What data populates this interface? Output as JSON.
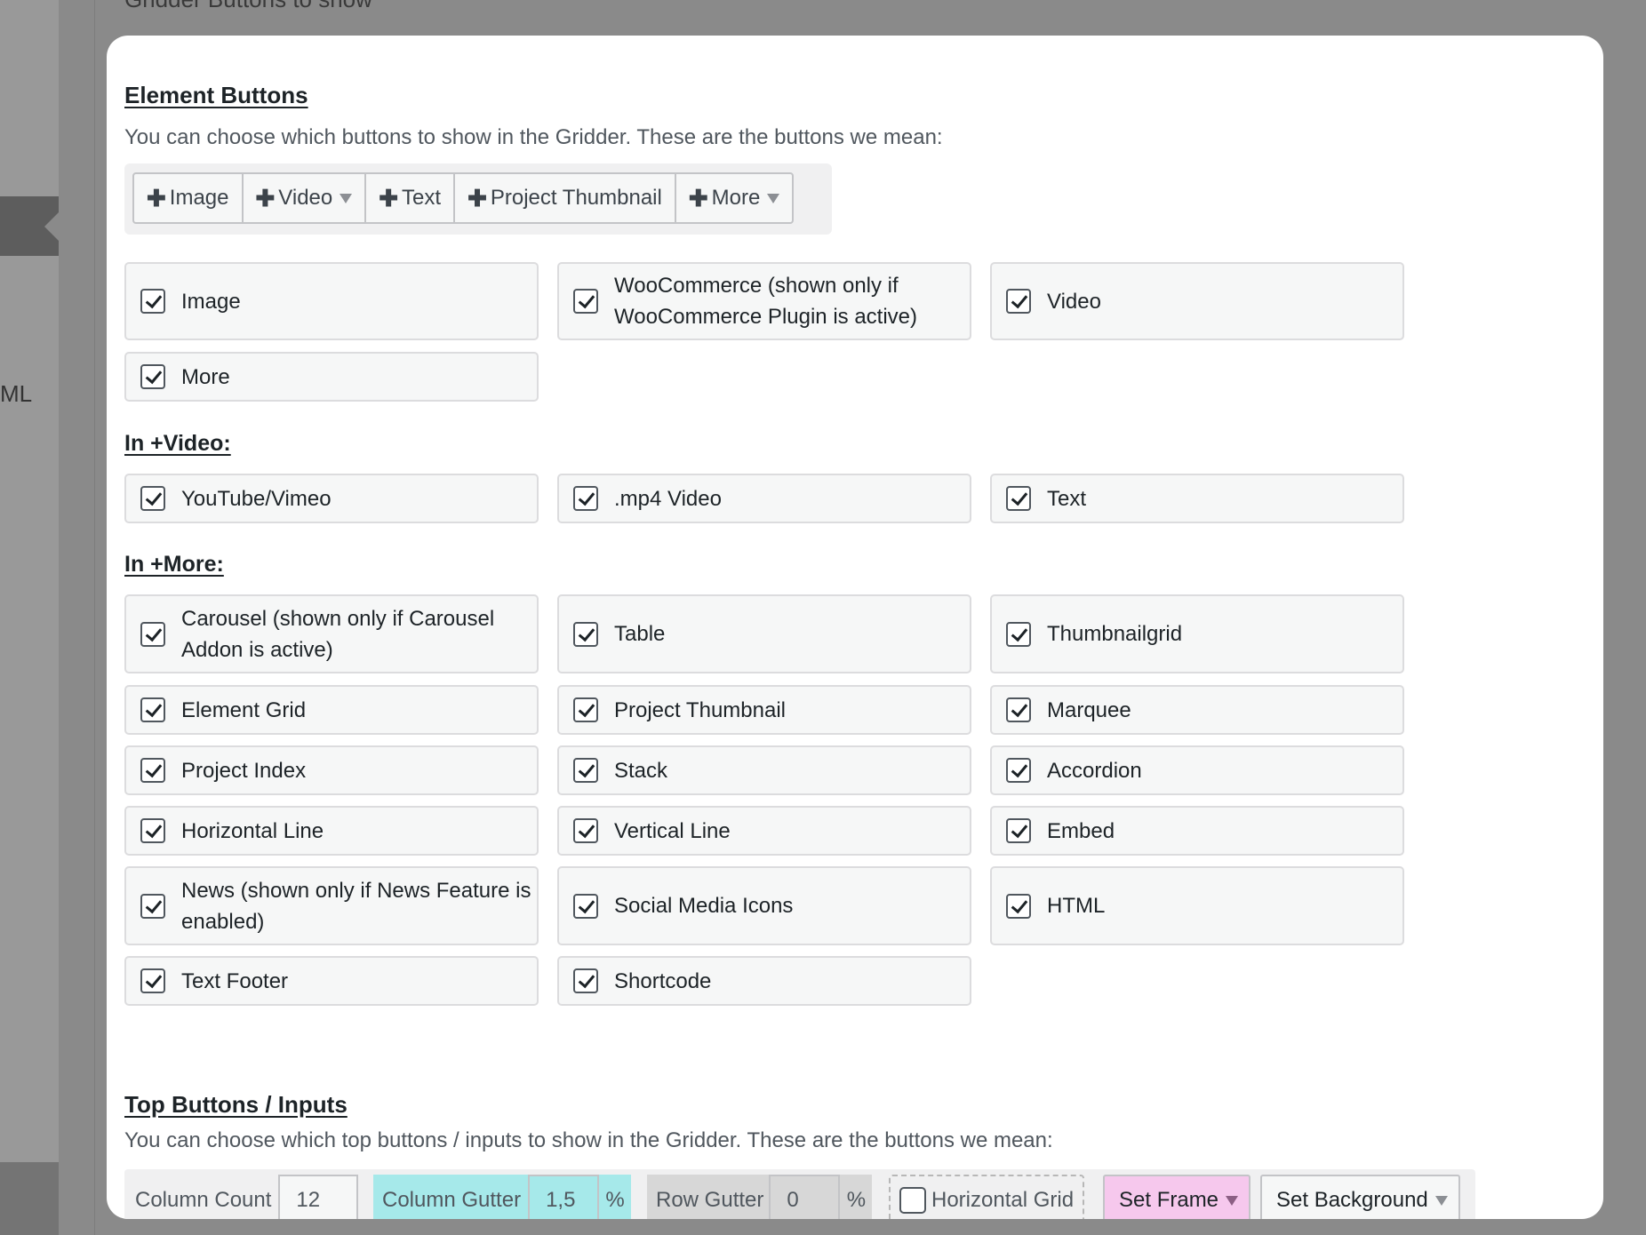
{
  "background": {
    "top_text": "Gridder Buttons to show",
    "side_text": "ML"
  },
  "element_buttons": {
    "heading": "Element Buttons",
    "description": "You can choose which buttons to show in the Gridder. These are the buttons we mean:",
    "sample_buttons": [
      {
        "label": "Image",
        "has_dropdown": false
      },
      {
        "label": "Video",
        "has_dropdown": true
      },
      {
        "label": "Text",
        "has_dropdown": false
      },
      {
        "label": "Project Thumbnail",
        "has_dropdown": false
      },
      {
        "label": "More",
        "has_dropdown": true
      }
    ],
    "options": [
      {
        "label": "Image",
        "checked": true
      },
      {
        "label": "WooCommerce (shown only if WooCommerce Plugin is active)",
        "checked": true
      },
      {
        "label": "Video",
        "checked": true
      },
      {
        "label": "More",
        "checked": true
      }
    ]
  },
  "in_video": {
    "heading": "In +Video:",
    "options": [
      {
        "label": "YouTube/Vimeo",
        "checked": true
      },
      {
        "label": ".mp4 Video",
        "checked": true
      },
      {
        "label": "Text",
        "checked": true
      }
    ]
  },
  "in_more": {
    "heading": "In +More:",
    "options": [
      {
        "label": "Carousel (shown only if Carousel Addon is active)",
        "checked": true
      },
      {
        "label": "Table",
        "checked": true
      },
      {
        "label": "Thumbnailgrid",
        "checked": true
      },
      {
        "label": "Element Grid",
        "checked": true
      },
      {
        "label": "Project Thumbnail",
        "checked": true
      },
      {
        "label": "Marquee",
        "checked": true
      },
      {
        "label": "Project Index",
        "checked": true
      },
      {
        "label": "Stack",
        "checked": true
      },
      {
        "label": "Accordion",
        "checked": true
      },
      {
        "label": "Horizontal Line",
        "checked": true
      },
      {
        "label": "Vertical Line",
        "checked": true
      },
      {
        "label": "Embed",
        "checked": true
      },
      {
        "label": "News (shown only if News Feature is enabled)",
        "checked": true
      },
      {
        "label": "Social Media Icons",
        "checked": true
      },
      {
        "label": "HTML",
        "checked": true
      },
      {
        "label": "Text Footer",
        "checked": true
      },
      {
        "label": "Shortcode",
        "checked": true
      }
    ]
  },
  "top_buttons": {
    "heading": "Top Buttons / Inputs",
    "description": "You can choose which top buttons / inputs to show in the Gridder. These are the buttons we mean:",
    "column_count": {
      "label": "Column Count",
      "value": "12"
    },
    "column_gutter": {
      "label": "Column Gutter",
      "value": "1,5",
      "unit": "%"
    },
    "row_gutter": {
      "label": "Row Gutter",
      "value": "0",
      "unit": "%"
    },
    "horizontal_grid": {
      "label": "Horizontal Grid",
      "checked": false
    },
    "set_frame": {
      "label": "Set Frame"
    },
    "set_background": {
      "label": "Set Background"
    }
  },
  "colors": {
    "column_gutter_bg": "#a6e9ea",
    "set_frame_bg": "#f6c8ed"
  }
}
